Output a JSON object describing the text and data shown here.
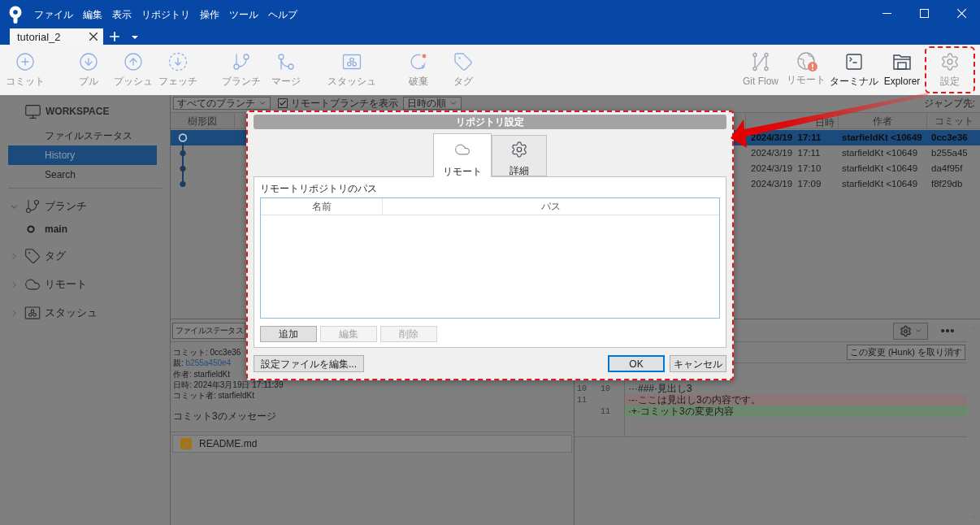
{
  "menu": [
    "ファイル",
    "編集",
    "表示",
    "リポジトリ",
    "操作",
    "ツール",
    "ヘルプ"
  ],
  "tabs": [
    {
      "label": "tutorial_2",
      "selected": true
    }
  ],
  "toolbar": {
    "left_groups": [
      [
        {
          "label": "コミット",
          "kind": "commit",
          "disabled": true
        }
      ],
      [
        {
          "label": "プル",
          "kind": "pull",
          "disabled": true
        },
        {
          "label": "プッシュ",
          "kind": "push",
          "disabled": true
        },
        {
          "label": "フェッチ",
          "kind": "fetch",
          "disabled": true
        }
      ],
      [
        {
          "label": "ブランチ",
          "kind": "branch",
          "disabled": true
        },
        {
          "label": "マージ",
          "kind": "merge",
          "disabled": true
        }
      ],
      [
        {
          "label": "スタッシュ",
          "kind": "stash",
          "disabled": true
        }
      ],
      [
        {
          "label": "破棄",
          "kind": "discard",
          "disabled": true
        },
        {
          "label": "タグ",
          "kind": "tag",
          "disabled": true
        }
      ]
    ],
    "right": [
      {
        "label": "Git Flow",
        "kind": "gitflow",
        "disabled": true,
        "alert": false,
        "annotated": false
      },
      {
        "label": "リモート",
        "kind": "remote",
        "disabled": true,
        "alert": true,
        "annotated": false
      },
      {
        "label": "ターミナル",
        "kind": "terminal",
        "disabled": false,
        "alert": false,
        "annotated": false
      },
      {
        "label": "Explorer",
        "kind": "explorer",
        "disabled": false,
        "alert": false,
        "annotated": false
      },
      {
        "label": "設定",
        "kind": "settings",
        "disabled": true,
        "alert": false,
        "annotated": true
      }
    ]
  },
  "sidebar": {
    "workspace": {
      "title": "WORKSPACE",
      "items": [
        {
          "label": "ファイルステータス",
          "selected": false
        },
        {
          "label": "History",
          "selected": true
        },
        {
          "label": "Search",
          "selected": false
        }
      ]
    },
    "groups": [
      {
        "label": "ブランチ",
        "kind": "branch",
        "expanded": true,
        "children": [
          {
            "label": "main",
            "current": true
          }
        ]
      },
      {
        "label": "タグ",
        "kind": "tag",
        "expanded": false
      },
      {
        "label": "リモート",
        "kind": "cloud",
        "expanded": false
      },
      {
        "label": "スタッシュ",
        "kind": "stash",
        "expanded": false
      }
    ]
  },
  "history": {
    "branch_filter": "すべてのブランチ",
    "show_remote": {
      "label": "リモートブランチを表示",
      "checked": true
    },
    "sort": "日時の順",
    "jump_label": "ジャンプ先:",
    "columns": {
      "graph": "樹形図",
      "date": "日時",
      "author": "作者",
      "commit": "コミット"
    },
    "rows": [
      {
        "date": "2024/3/19  17:11",
        "author": "starfieldKt <10649",
        "commit": "0cc3e36",
        "selected": true,
        "head": true
      },
      {
        "date": "2024/3/19  17:11",
        "author": "starfieldKt <10649",
        "commit": "b255a45",
        "selected": false,
        "head": false
      },
      {
        "date": "2024/3/19  17:10",
        "author": "starfieldKt <10649",
        "commit": "da4f95f",
        "selected": false,
        "head": false
      },
      {
        "date": "2024/3/19  17:09",
        "author": "starfieldKt <10649",
        "commit": "f8f29db",
        "selected": false,
        "head": false
      }
    ]
  },
  "details": {
    "view": "ファイルステータス",
    "fields": [
      {
        "label": "コミット:",
        "value": "0cc3e36",
        "kind": "text"
      },
      {
        "label": "親:",
        "value": "b255a450e4",
        "kind": "link"
      },
      {
        "label": "作者:",
        "value": "starfieldKt",
        "kind": "text"
      },
      {
        "label": "日時:",
        "value": "2024年3月19日 17:11:39",
        "kind": "text"
      },
      {
        "label": "コミット者:",
        "value": "starfieldKt",
        "kind": "text"
      }
    ],
    "message": "コミット3のメッセージ",
    "files": [
      {
        "name": "README.md",
        "kind": "modified"
      }
    ]
  },
  "diff": {
    "hunk_button": "この変更 (Hunk) を取り消す",
    "lines": [
      {
        "old": "10",
        "new": "10",
        "kind": "context",
        "text": "···###·見出し3"
      },
      {
        "old": "11",
        "kind": "removed",
        "text": "·-·ここは見出し3の内容です。"
      },
      {
        "new": "11",
        "kind": "added",
        "text": "·+·コミット3の変更内容"
      }
    ]
  },
  "dialog": {
    "title": "リポジトリ設定",
    "annotated": true,
    "tabs": [
      {
        "label": "リモート",
        "kind": "cloud",
        "selected": true
      },
      {
        "label": "詳細",
        "kind": "gear",
        "selected": false
      }
    ],
    "section_label": "リモートリポジトリのパス",
    "columns": [
      "名前",
      "パス"
    ],
    "list_buttons": [
      {
        "label": "追加",
        "disabled": false
      },
      {
        "label": "編集",
        "disabled": true
      },
      {
        "label": "削除",
        "disabled": true
      }
    ],
    "edit_config_button": "設定ファイルを編集...",
    "buttons": [
      {
        "label": "OK",
        "default": true
      },
      {
        "label": "キャンセル",
        "default": false
      }
    ]
  },
  "annotation": {
    "arrow": true
  }
}
